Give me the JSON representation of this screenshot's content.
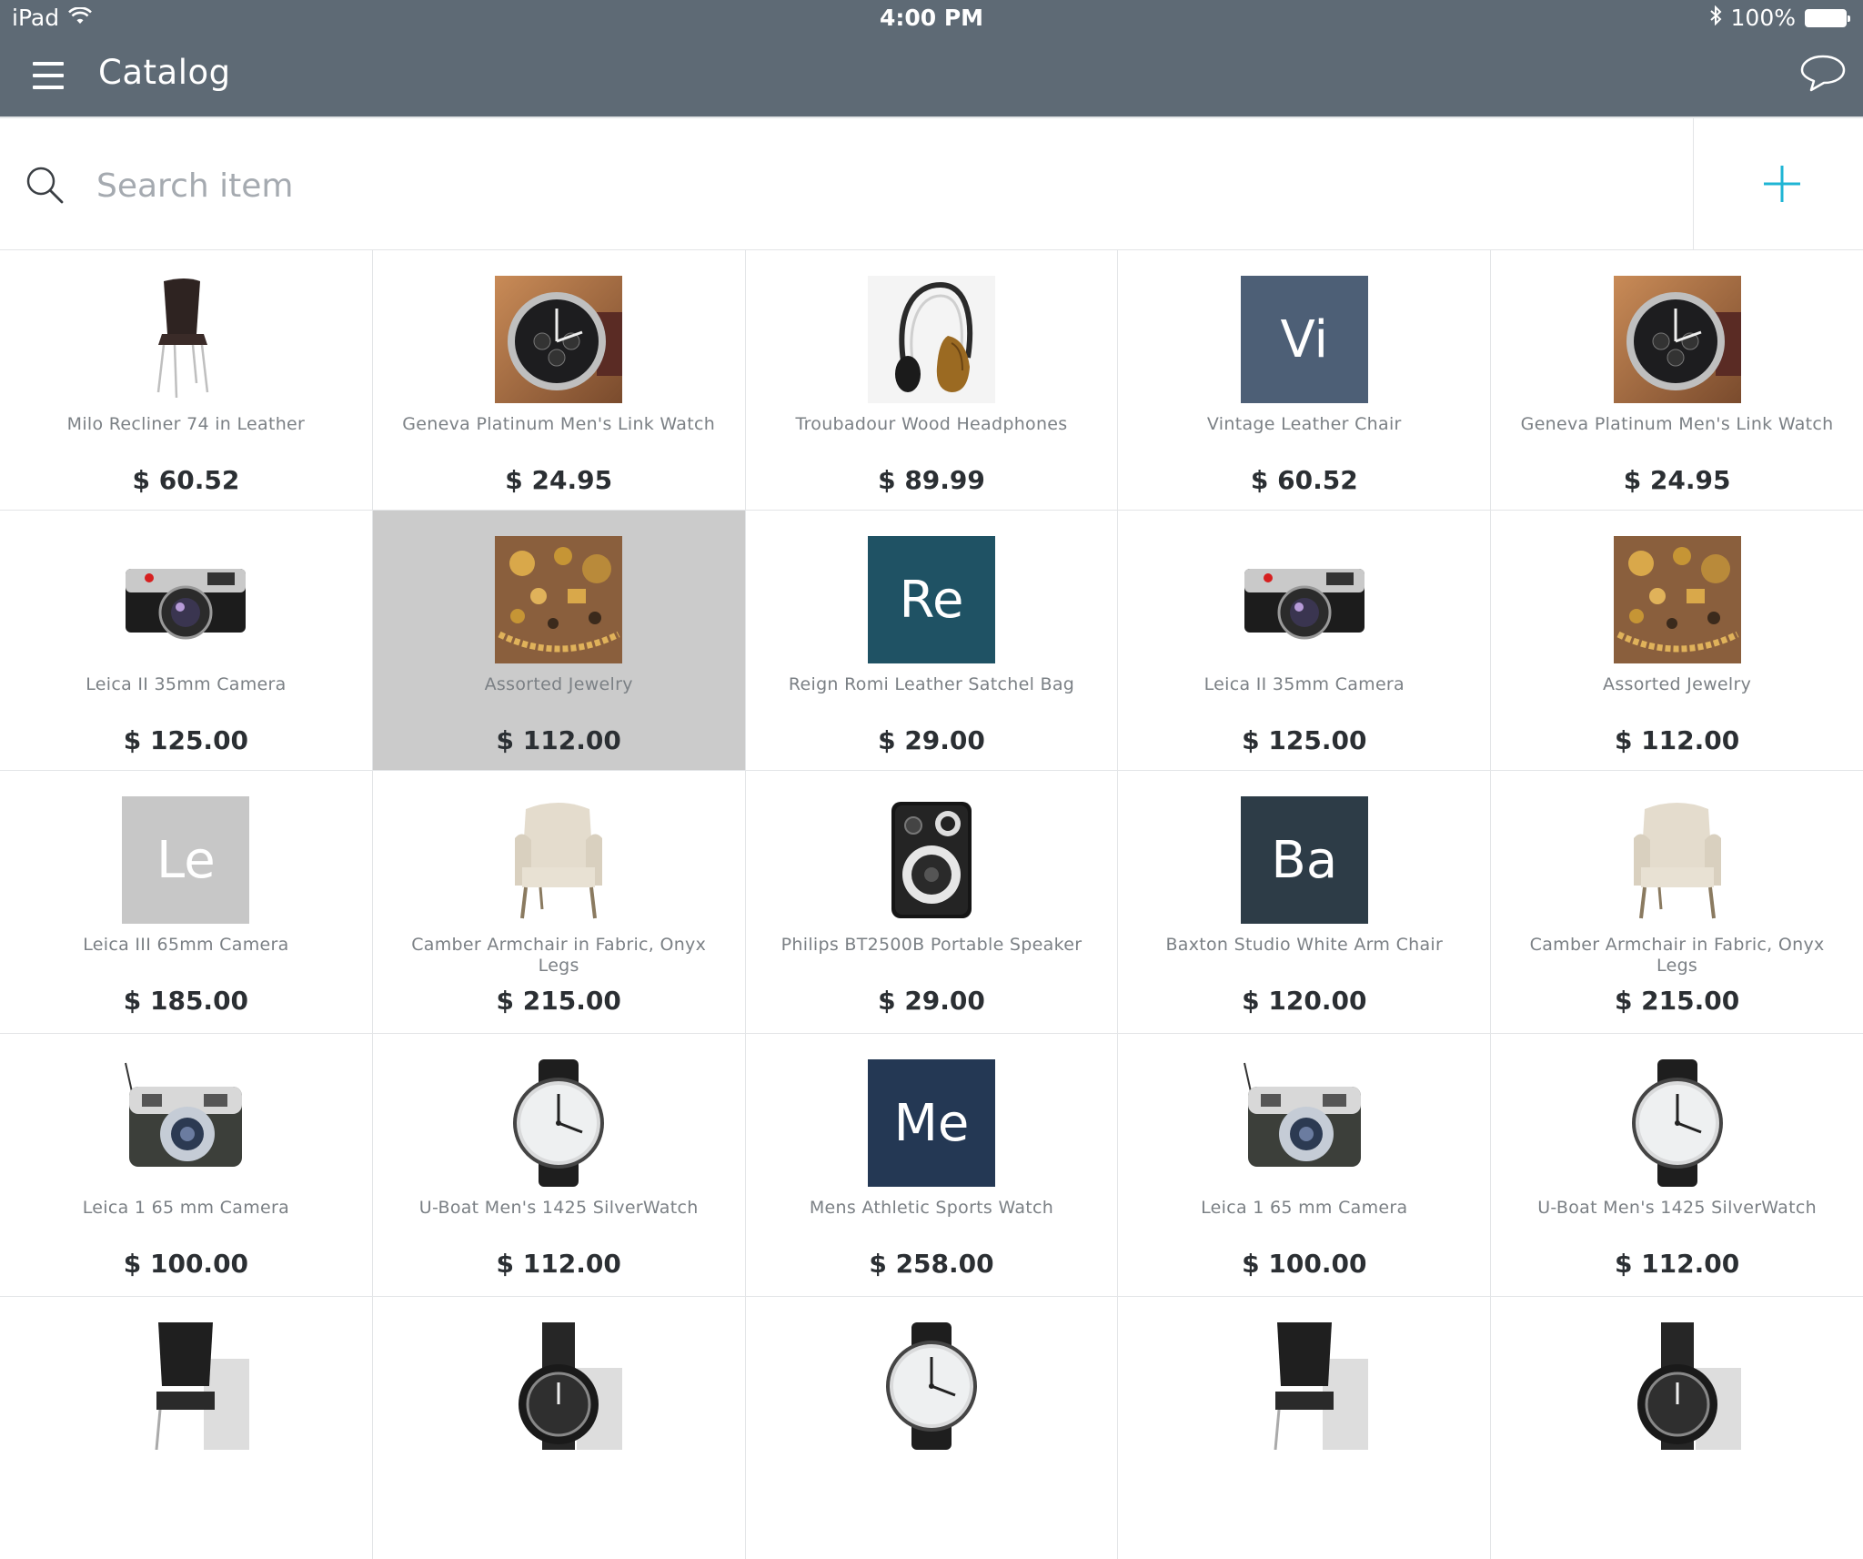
{
  "status_bar": {
    "device": "iPad",
    "time": "4:00 PM",
    "battery": "100%"
  },
  "header": {
    "title": "Catalog",
    "menu_icon": "hamburger-menu-icon",
    "chat_icon": "speech-bubble-icon",
    "background_color": "#5e6a75"
  },
  "search": {
    "placeholder": "Search item",
    "value": "",
    "add_icon": "plus-icon",
    "accent_color": "#1fb5d4"
  },
  "items": [
    {
      "name": "Milo Recliner 74 in Leather",
      "price": "$ 60.52",
      "thumb": "chair"
    },
    {
      "name": "Geneva Platinum Men's Link Watch",
      "price": "$ 24.95",
      "thumb": "watch-photo"
    },
    {
      "name": "Troubadour Wood Headphones",
      "price": "$ 89.99",
      "thumb": "headphones"
    },
    {
      "name": "Vintage Leather Chair",
      "price": "$ 60.52",
      "thumb": "initials",
      "initials": "Vi",
      "color": "#4d5f76"
    },
    {
      "name": "Geneva Platinum Men's Link Watch",
      "price": "$ 24.95",
      "thumb": "watch-photo"
    },
    {
      "name": "Leica II 35mm Camera",
      "price": "$ 125.00",
      "thumb": "camera"
    },
    {
      "name": "Assorted Jewelry",
      "price": "$ 112.00",
      "thumb": "jewelry",
      "selected": true
    },
    {
      "name": "Reign Romi Leather Satchel Bag",
      "price": "$ 29.00",
      "thumb": "initials",
      "initials": "Re",
      "color": "#1f5264"
    },
    {
      "name": "Leica II 35mm Camera",
      "price": "$ 125.00",
      "thumb": "camera"
    },
    {
      "name": "Assorted Jewelry",
      "price": "$ 112.00",
      "thumb": "jewelry"
    },
    {
      "name": "Leica III 65mm Camera",
      "price": "$ 185.00",
      "thumb": "initials",
      "initials": "Le",
      "color": "#c7c7c7"
    },
    {
      "name": "Camber Armchair in Fabric, Onyx Legs",
      "price": "$ 215.00",
      "thumb": "armchair"
    },
    {
      "name": "Philips BT2500B Portable Speaker",
      "price": "$ 29.00",
      "thumb": "speaker"
    },
    {
      "name": "Baxton Studio White Arm Chair",
      "price": "$ 120.00",
      "thumb": "initials",
      "initials": "Ba",
      "color": "#2d3c47"
    },
    {
      "name": "Camber Armchair in Fabric, Onyx Legs",
      "price": "$ 215.00",
      "thumb": "armchair"
    },
    {
      "name": "Leica 1 65 mm Camera",
      "price": "$ 100.00",
      "thumb": "vintage-camera"
    },
    {
      "name": "U-Boat Men's 1425 SilverWatch",
      "price": "$ 112.00",
      "thumb": "silver-watch"
    },
    {
      "name": "Mens Athletic Sports Watch",
      "price": "$ 258.00",
      "thumb": "initials",
      "initials": "Me",
      "color": "#243854"
    },
    {
      "name": "Leica 1 65 mm Camera",
      "price": "$ 100.00",
      "thumb": "vintage-camera"
    },
    {
      "name": "U-Boat Men's 1425 SilverWatch",
      "price": "$ 112.00",
      "thumb": "silver-watch"
    },
    {
      "name": "",
      "price": "",
      "thumb": "office-chair"
    },
    {
      "name": "",
      "price": "",
      "thumb": "black-watch"
    },
    {
      "name": "",
      "price": "",
      "thumb": "silver-watch"
    },
    {
      "name": "",
      "price": "",
      "thumb": "office-chair"
    },
    {
      "name": "",
      "price": "",
      "thumb": "black-watch"
    }
  ]
}
